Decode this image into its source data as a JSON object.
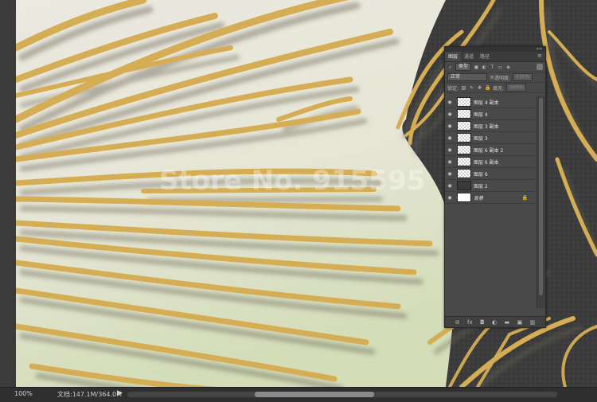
{
  "status_bar": {
    "zoom": "100%",
    "doc_info": "文档:147.1M/364.0M",
    "play_glyph": "▶"
  },
  "watermark": {
    "text": "Store No. 915595"
  },
  "layers_panel": {
    "tabs": [
      "图层",
      "通道",
      "路径"
    ],
    "active_tab": "图层",
    "menu_glyph": "≡",
    "grip_glyph": "««",
    "filter_kind": "类型",
    "blend_mode": "正常",
    "opacity_label": "不透明度:",
    "opacity_value": "100%",
    "lock_label": "锁定:",
    "fill_label": "填充:",
    "fill_value": "100%",
    "layers": [
      {
        "name": "图层 4 副本",
        "visible": true,
        "thumb": "transparent"
      },
      {
        "name": "图层 4",
        "visible": true,
        "thumb": "transparent"
      },
      {
        "name": "图层 3 副本",
        "visible": true,
        "thumb": "transparent"
      },
      {
        "name": "图层 3",
        "visible": true,
        "thumb": "transparent"
      },
      {
        "name": "图层 6 副本 2",
        "visible": true,
        "thumb": "transparent"
      },
      {
        "name": "图层 6 副本",
        "visible": true,
        "thumb": "transparent"
      },
      {
        "name": "图层 6",
        "visible": true,
        "thumb": "transparent"
      },
      {
        "name": "图层 2",
        "visible": true,
        "thumb": "dark"
      },
      {
        "name": "背景",
        "visible": true,
        "thumb": "white",
        "locked": true
      }
    ],
    "bottom_icons": [
      "link-icon",
      "fx-icon",
      "mask-icon",
      "adjustment-icon",
      "group-icon",
      "new-layer-icon",
      "trash-icon"
    ],
    "bottom_glyphs": [
      "⊖",
      "fx",
      "◘",
      "◐",
      "▬",
      "▣",
      "▥"
    ]
  },
  "colors": {
    "gold": "#d4ad55",
    "gold_dark": "#8c6b2a",
    "canvas_light": "#e8e6dc",
    "canvas_green": "#d7dfbf",
    "wall_dark": "#3a3a3a"
  }
}
